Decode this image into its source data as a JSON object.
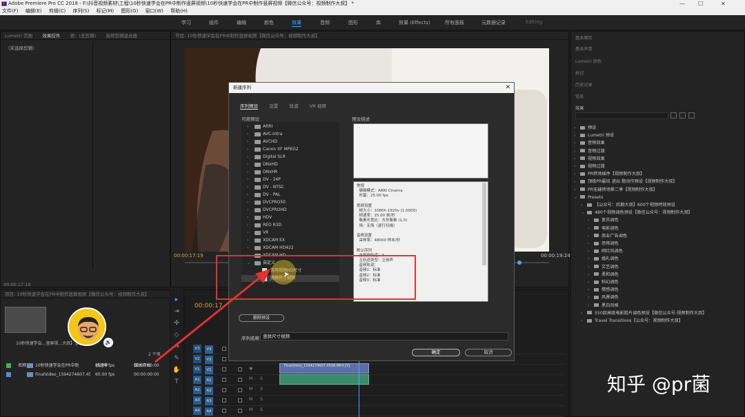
{
  "window": {
    "title": "Adobe Premiere Pro CC 2018 - F:\\抖音视频素材\\工程\\10秒快速学会在PR中制作竖屏视频\\10秒快速学会在PR中制作竖屏视频【微信公众号：视频制作大叔】 *",
    "app_logo": "Pr"
  },
  "menu": [
    "文件(F)",
    "编辑(E)",
    "剪辑(C)",
    "序列(S)",
    "标记(M)",
    "图形(G)",
    "窗口(W)",
    "帮助(H)"
  ],
  "workspaces": {
    "items": [
      "学习",
      "组件",
      "编辑",
      "颜色",
      "效果",
      "音频",
      "图形",
      "库",
      "效果 (Effects)",
      "所有面板",
      "元数据记录",
      "Editing"
    ],
    "active": "效果"
  },
  "left_panel": {
    "tabs": [
      "Lumetri 范围",
      "效果控件",
      "源：(无剪辑)",
      "音频剪辑混合器"
    ],
    "empty_label": "（未选择剪辑）",
    "timecode": "00:00:17:19"
  },
  "program": {
    "tab_title": "节目: 10秒快速学会在PR中制作竖屏视频【微信公众号：视频制作大叔】",
    "timecode_left": "00:00:17:19",
    "timecode_right": "00:00:19:24"
  },
  "project_panel": {
    "tab_title": "项目: 10秒快速学会在PR中制作竖屏视频【微信公众号：视频制作大叔】",
    "file_name": "10秒快速学会...竖屏视...大叔】.prproj",
    "item_count": "2 个项",
    "columns": [
      "名称",
      "帧速率",
      "媒体开始"
    ],
    "rows": [
      {
        "name": "10秒快速学会在PR中制",
        "fps": "25.00 fps",
        "start": "00:00:00:00",
        "color": "#3ab54a"
      },
      {
        "name": "FinalVideo_1594274607.4598",
        "fps": "60.00 fps",
        "start": "00:00:00:00",
        "color": "#4a8fd8"
      }
    ]
  },
  "timeline": {
    "timecode": "00:00:17",
    "tracks": [
      "V3",
      "V2",
      "V1",
      "A1",
      "A2",
      "A3",
      "A4"
    ],
    "clip_label": "FinalVideo_1594274607.4598.MP4 [V]"
  },
  "dialog": {
    "title": "新建序列",
    "close_glyph": "✕",
    "tabs": [
      "序列预设",
      "设置",
      "轨道",
      "VR 视频"
    ],
    "active_tab": "序列预设",
    "available_label": "可用预设",
    "preset_desc_label": "预设描述",
    "presets": [
      "ARRI",
      "AVC-Intra",
      "AVCHD",
      "Canon XF MPEG2",
      "Digital SLR",
      "DNxHD",
      "DNxHR",
      "DV - 24P",
      "DV - NTSC",
      "DV - PAL",
      "DVCPRO50",
      "DVCPROHD",
      "HDV",
      "RED R3D",
      "VR",
      "XDCAM EX",
      "XDCAM HD422",
      "XDCAM HD"
    ],
    "custom_folder": "自定义",
    "custom_items": [
      "常用视频HD尺寸",
      "竖屏尺寸视频"
    ],
    "selected_item": "竖屏尺寸视频",
    "info_text": "常规\n  编辑模式：ARRI Cinema\n  时基：25.00 fps\n\n视频设置\n  帧大小：1080h 1920v (1.0000)\n  帧速率：25.00 帧/秒\n  像素长宽比：方形像素 (1.0)\n  场：无场（逐行扫描）\n\n音频设置\n  采样率：48000 样本/秒\n\n默认序列\n  总视频轨道：3\n  主轨道类型：立体声\n  音频轨道：\n  音频1：标准\n  音频2：标准\n  音频3：标准",
    "delete_btn": "删除预设",
    "seq_name_label": "序列名称：",
    "seq_name_value": "竖屏尺寸视频",
    "ok_btn": "确定",
    "cancel_btn": "取消"
  },
  "right_panels": [
    "基本图形",
    "基本声音",
    "Lumetri 颜色",
    "标记",
    "历史记录",
    "信息",
    "效果"
  ],
  "effects_tree": [
    {
      "label": "预设",
      "depth": 0,
      "open": false
    },
    {
      "label": "Lumetri 预设",
      "depth": 0,
      "open": false
    },
    {
      "label": "音频效果",
      "depth": 0,
      "open": false
    },
    {
      "label": "音频过渡",
      "depth": 0,
      "open": false
    },
    {
      "label": "视频效果",
      "depth": 0,
      "open": false
    },
    {
      "label": "视频过渡",
      "depth": 0,
      "open": false
    },
    {
      "label": "PR转场插件【视频制作大叔】",
      "depth": 0,
      "open": false
    },
    {
      "label": "顶级PR最炫 进出 题动作预设【视频制作大叔】",
      "depth": 0,
      "open": false
    },
    {
      "label": "PR无缝转场第二季【视频制作大叔】",
      "depth": 0,
      "open": false
    },
    {
      "label": "Presets",
      "depth": 0,
      "open": true
    },
    {
      "label": "【公众号：后期大叔】600个视频特效预设",
      "depth": 1,
      "open": false
    },
    {
      "label": "480个视频调色预设【微信公众号：视频制作大叔】",
      "depth": 1,
      "open": true
    },
    {
      "label": "复古调色",
      "depth": 2,
      "open": false
    },
    {
      "label": "电影调色",
      "depth": 2,
      "open": false
    },
    {
      "label": "商业广告调色",
      "depth": 2,
      "open": false
    },
    {
      "label": "恐怖调色",
      "depth": 2,
      "open": false
    },
    {
      "label": "网红风调色",
      "depth": 2,
      "open": false
    },
    {
      "label": "婚礼调色",
      "depth": 2,
      "open": false
    },
    {
      "label": "文艺调色",
      "depth": 2,
      "open": false
    },
    {
      "label": "柔和调色",
      "depth": 2,
      "open": false
    },
    {
      "label": "科幻调色",
      "depth": 2,
      "open": false
    },
    {
      "label": "情感调色",
      "depth": 2,
      "open": false
    },
    {
      "label": "风景调色",
      "depth": 2,
      "open": false
    },
    {
      "label": "黑白风格",
      "depth": 2,
      "open": false
    },
    {
      "label": "550款高级电影胶片调色预设【微信公众号:视频制作大叔】",
      "depth": 1,
      "open": false
    },
    {
      "label": "Travel Transitions【公众号：视频制作大叔】",
      "depth": 1,
      "open": false
    }
  ],
  "watermark": "知乎 @pr菌",
  "colors": {
    "accent": "#4aa3ff",
    "highlight": "#e53131",
    "timecode": "#d8a832"
  }
}
